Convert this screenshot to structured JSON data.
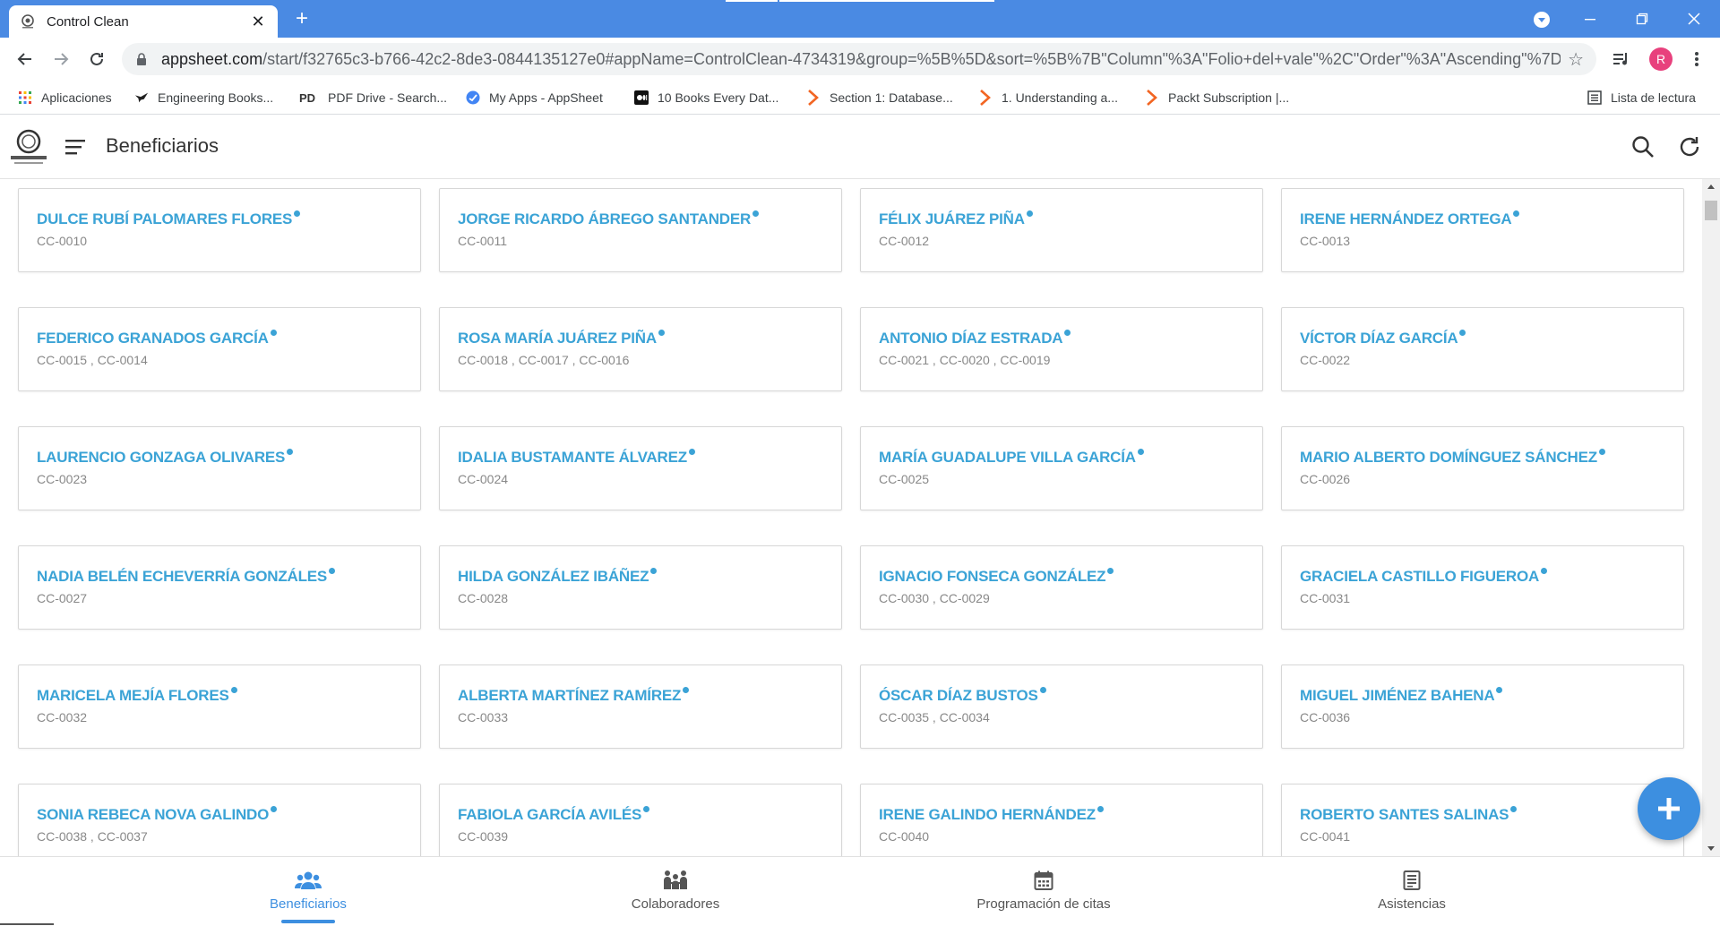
{
  "browser": {
    "tab_title": "Control Clean",
    "url_host": "appsheet.com",
    "url_rest": "/start/f32765c3-b766-42c2-8de3-0844135127e0#appName=ControlClean-4734319&group=%5B%5D&sort=%5B%7B\"Column\"%3A\"Folio+del+vale\"%2C\"Order\"%3A\"Ascending\"%7D%5...",
    "avatar_letter": "R",
    "bookmarks": [
      {
        "label": "Aplicaciones",
        "icon": "apps-grid-icon"
      },
      {
        "label": "Engineering Books...",
        "icon": "eagle-icon"
      },
      {
        "label": "PDF Drive - Search...",
        "icon": "pdf-drive-icon"
      },
      {
        "label": "My Apps - AppSheet",
        "icon": "appsheet-icon"
      },
      {
        "label": "10 Books Every Dat...",
        "icon": "medium-icon"
      },
      {
        "label": "Section 1: Database...",
        "icon": "packt-icon"
      },
      {
        "label": "1. Understanding a...",
        "icon": "packt-icon"
      },
      {
        "label": "Packt Subscription |...",
        "icon": "packt-icon"
      }
    ],
    "reading_list": "Lista de lectura"
  },
  "app": {
    "title": "Beneficiarios",
    "accent_color": "#3ba3d6",
    "fab_color": "#3d8fe0"
  },
  "cards": [
    {
      "name": "DULCE RUBÍ PALOMARES FLORES",
      "folio": "CC-0010"
    },
    {
      "name": "JORGE RICARDO ÁBREGO SANTANDER",
      "folio": "CC-0011"
    },
    {
      "name": "FÉLIX JUÁREZ PIÑA",
      "folio": "CC-0012"
    },
    {
      "name": "IRENE HERNÁNDEZ ORTEGA",
      "folio": "CC-0013"
    },
    {
      "name": "FEDERICO GRANADOS GARCÍA",
      "folio": "CC-0015 , CC-0014"
    },
    {
      "name": "ROSA MARÍA JUÁREZ PIÑA",
      "folio": "CC-0018 , CC-0017 , CC-0016"
    },
    {
      "name": "ANTONIO DÍAZ ESTRADA",
      "folio": "CC-0021 , CC-0020 , CC-0019"
    },
    {
      "name": "VÍCTOR DÍAZ GARCÍA",
      "folio": "CC-0022"
    },
    {
      "name": "LAURENCIO GONZAGA OLIVARES",
      "folio": "CC-0023"
    },
    {
      "name": "IDALIA BUSTAMANTE ÁLVAREZ",
      "folio": "CC-0024"
    },
    {
      "name": "MARÍA GUADALUPE VILLA GARCÍA",
      "folio": "CC-0025"
    },
    {
      "name": "MARIO ALBERTO DOMÍNGUEZ SÁNCHEZ",
      "folio": "CC-0026"
    },
    {
      "name": "NADIA BELÉN ECHEVERRÍA GONZÁLES",
      "folio": "CC-0027"
    },
    {
      "name": "HILDA GONZÁLEZ IBÁÑEZ",
      "folio": "CC-0028"
    },
    {
      "name": "IGNACIO FONSECA GONZÁLEZ",
      "folio": "CC-0030 , CC-0029"
    },
    {
      "name": "GRACIELA CASTILLO FIGUEROA",
      "folio": "CC-0031"
    },
    {
      "name": "MARICELA MEJÍA FLORES",
      "folio": "CC-0032"
    },
    {
      "name": "ALBERTA MARTÍNEZ RAMÍREZ",
      "folio": "CC-0033"
    },
    {
      "name": "ÓSCAR DÍAZ BUSTOS",
      "folio": "CC-0035 , CC-0034"
    },
    {
      "name": "MIGUEL JIMÉNEZ BAHENA",
      "folio": "CC-0036"
    },
    {
      "name": "SONIA REBECA NOVA GALINDO",
      "folio": "CC-0038 , CC-0037"
    },
    {
      "name": "FABIOLA GARCÍA AVILÉS",
      "folio": "CC-0039"
    },
    {
      "name": "IRENE GALINDO HERNÁNDEZ",
      "folio": "CC-0040"
    },
    {
      "name": "ROBERTO SANTES SALINAS",
      "folio": "CC-0041"
    }
  ],
  "bottom_nav": [
    {
      "label": "Beneficiarios",
      "icon": "people-icon",
      "active": true
    },
    {
      "label": "Colaboradores",
      "icon": "team-icon",
      "active": false
    },
    {
      "label": "Programación de citas",
      "icon": "calendar-icon",
      "active": false
    },
    {
      "label": "Asistencias",
      "icon": "list-icon",
      "active": false
    }
  ]
}
